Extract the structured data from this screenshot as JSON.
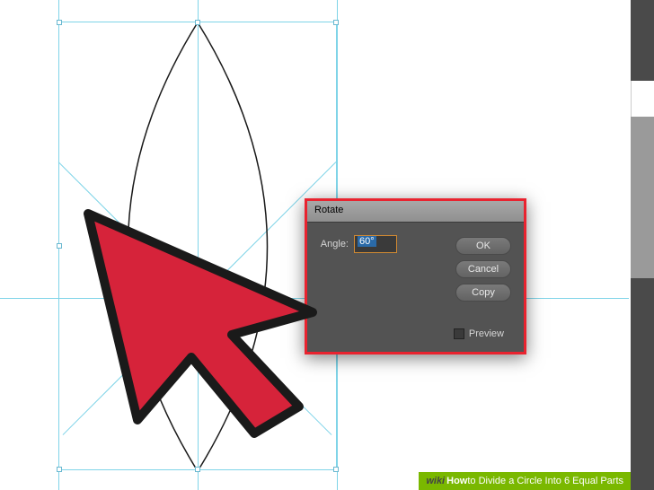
{
  "dialog": {
    "title": "Rotate",
    "angle_label": "Angle:",
    "angle_value": "60°",
    "ok": "OK",
    "cancel": "Cancel",
    "copy": "Copy",
    "preview_label": "Preview",
    "preview_checked": false
  },
  "caption": {
    "brand": "wiki",
    "how": "How",
    "text": " to Divide a Circle Into 6 Equal Parts"
  }
}
